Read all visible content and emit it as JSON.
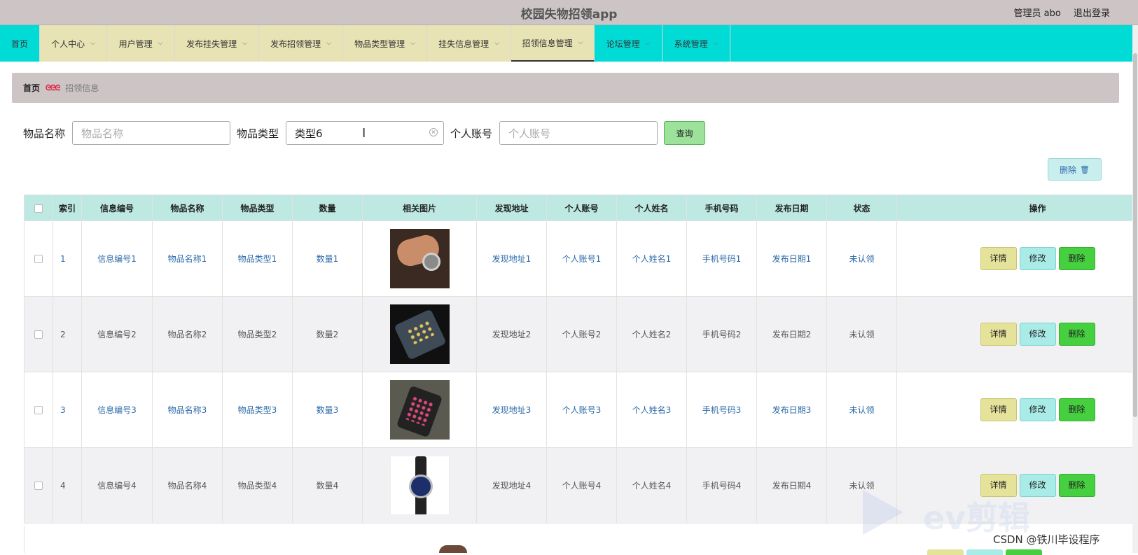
{
  "header": {
    "title": "校园失物招领app",
    "admin_label": "管理员 abo",
    "logout_label": "退出登录"
  },
  "nav": [
    {
      "label": "首页",
      "dropdown": false,
      "style": "cyan"
    },
    {
      "label": "个人中心",
      "dropdown": true,
      "style": "beige"
    },
    {
      "label": "用户管理",
      "dropdown": true,
      "style": "beige"
    },
    {
      "label": "发布挂失管理",
      "dropdown": true,
      "style": "beige"
    },
    {
      "label": "发布招领管理",
      "dropdown": true,
      "style": "beige"
    },
    {
      "label": "物品类型管理",
      "dropdown": true,
      "style": "beige"
    },
    {
      "label": "挂失信息管理",
      "dropdown": true,
      "style": "beige"
    },
    {
      "label": "招领信息管理",
      "dropdown": true,
      "style": "beige",
      "active": true
    },
    {
      "label": "论坛管理",
      "dropdown": true,
      "style": "cyan"
    },
    {
      "label": "系统管理",
      "dropdown": true,
      "style": "cyan"
    }
  ],
  "breadcrumb": {
    "home": "首页",
    "separator": "ᘓᘓᘓ",
    "current": "招领信息"
  },
  "search": {
    "name_label": "物品名称",
    "name_placeholder": "物品名称",
    "name_value": "",
    "type_label": "物品类型",
    "type_value": "类型6",
    "account_label": "个人账号",
    "account_placeholder": "个人账号",
    "account_value": "",
    "query_label": "查询"
  },
  "bulk_delete_label": "删除",
  "table": {
    "headers": [
      "索引",
      "信息编号",
      "物品名称",
      "物品类型",
      "数量",
      "相关图片",
      "发现地址",
      "个人账号",
      "个人姓名",
      "手机号码",
      "发布日期",
      "状态",
      "操作"
    ],
    "rows": [
      {
        "index": "1",
        "info_no": "信息编号1",
        "name": "物品名称1",
        "type": "物品类型1",
        "qty": "数量1",
        "image": "watch-on-wrist",
        "address": "发现地址1",
        "account": "个人账号1",
        "person": "个人姓名1",
        "phone": "手机号码1",
        "date": "发布日期1",
        "status": "未认领"
      },
      {
        "index": "2",
        "info_no": "信息编号2",
        "name": "物品名称2",
        "type": "物品类型2",
        "qty": "数量2",
        "image": "phone-dark",
        "address": "发现地址2",
        "account": "个人账号2",
        "person": "个人姓名2",
        "phone": "手机号码2",
        "date": "发布日期2",
        "status": "未认领"
      },
      {
        "index": "3",
        "info_no": "信息编号3",
        "name": "物品名称3",
        "type": "物品类型3",
        "qty": "数量3",
        "image": "phone-in-hand",
        "address": "发现地址3",
        "account": "个人账号3",
        "person": "个人姓名3",
        "phone": "手机号码3",
        "date": "发布日期3",
        "status": "未认领"
      },
      {
        "index": "4",
        "info_no": "信息编号4",
        "name": "物品名称4",
        "type": "物品类型4",
        "qty": "数量4",
        "image": "leather-watch",
        "address": "发现地址4",
        "account": "个人账号4",
        "person": "个人姓名4",
        "phone": "手机号码4",
        "date": "发布日期4",
        "status": "未认领"
      }
    ],
    "actions": {
      "detail": "详情",
      "edit": "修改",
      "delete": "删除"
    }
  },
  "overlay": {
    "watermark": "ev剪辑",
    "credit": "CSDN @铁川毕设程序"
  },
  "colors": {
    "nav_cyan": "#00dbd6",
    "nav_beige": "#e7e3b4",
    "header_bg": "#cdc5c5",
    "table_head": "#bde9e2",
    "link_blue": "#2a69a8",
    "delete_green": "#46d040"
  }
}
